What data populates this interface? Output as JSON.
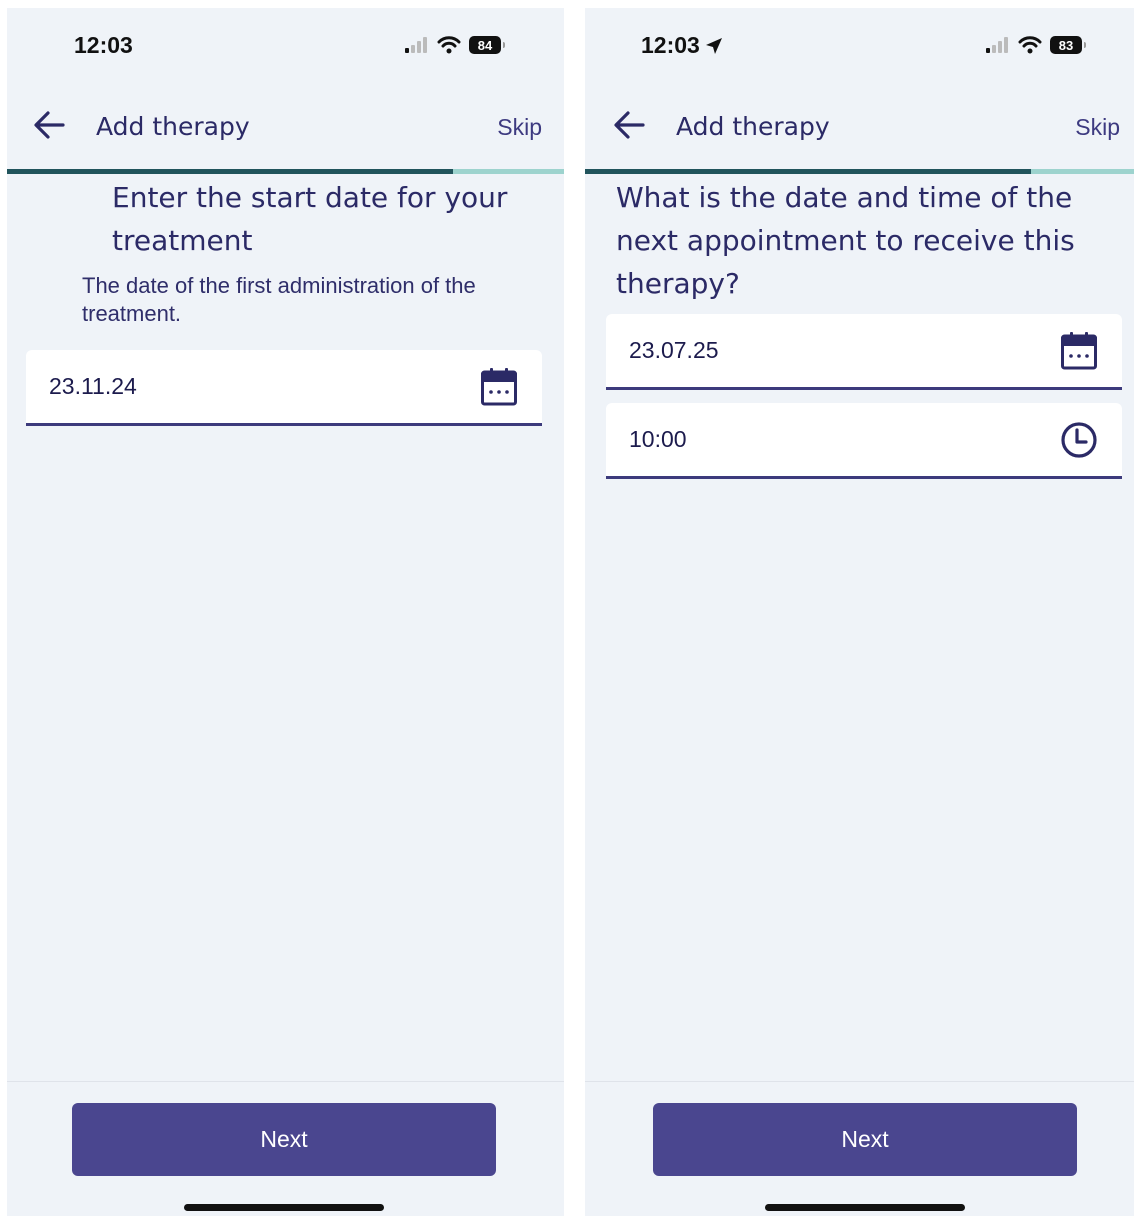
{
  "colors": {
    "background": "#eff3f8",
    "primary": "#4a468f",
    "text": "#2b2a66",
    "progress_fill": "#21545c",
    "progress_track": "#9dd3ce"
  },
  "screens": [
    {
      "status": {
        "time": "12:03",
        "battery": "84",
        "location_arrow": false
      },
      "header": {
        "title": "Add therapy",
        "skip_label": "Skip"
      },
      "progress": 0.8,
      "question": "Enter the start date for your treatment",
      "subtitle": "The date of the first administration of the treatment.",
      "fields": {
        "date": {
          "value": "23.11.24",
          "icon": "calendar-icon"
        }
      },
      "next_label": "Next"
    },
    {
      "status": {
        "time": "12:03",
        "battery": "83",
        "location_arrow": true
      },
      "header": {
        "title": "Add therapy",
        "skip_label": "Skip"
      },
      "progress": 0.8,
      "question": "What is the date and time of the next appointment to receive this therapy?",
      "fields": {
        "date": {
          "value": "23.07.25",
          "icon": "calendar-icon"
        },
        "time": {
          "value": "10:00",
          "icon": "clock-icon"
        }
      },
      "next_label": "Next"
    }
  ]
}
